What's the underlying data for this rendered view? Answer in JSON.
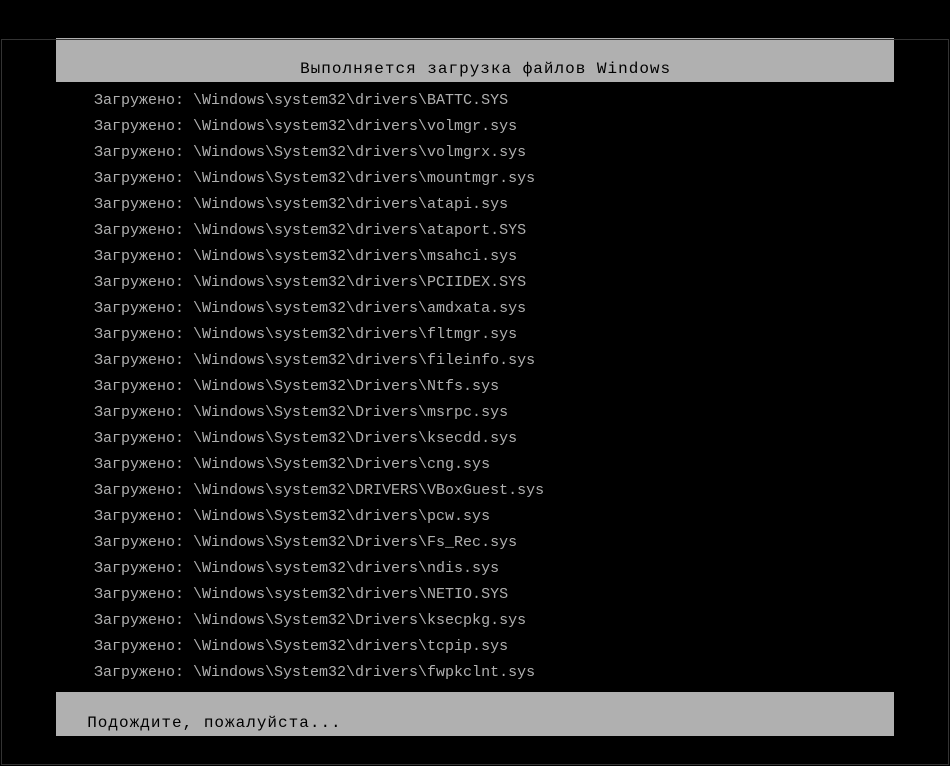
{
  "header": {
    "title": "Выполняется загрузка файлов Windows"
  },
  "log": {
    "prefix": "Загружено:",
    "files": [
      "\\Windows\\system32\\drivers\\BATTC.SYS",
      "\\Windows\\system32\\drivers\\volmgr.sys",
      "\\Windows\\System32\\drivers\\volmgrx.sys",
      "\\Windows\\System32\\drivers\\mountmgr.sys",
      "\\Windows\\system32\\drivers\\atapi.sys",
      "\\Windows\\system32\\drivers\\ataport.SYS",
      "\\Windows\\system32\\drivers\\msahci.sys",
      "\\Windows\\system32\\drivers\\PCIIDEX.SYS",
      "\\Windows\\system32\\drivers\\amdxata.sys",
      "\\Windows\\system32\\drivers\\fltmgr.sys",
      "\\Windows\\system32\\drivers\\fileinfo.sys",
      "\\Windows\\System32\\Drivers\\Ntfs.sys",
      "\\Windows\\System32\\Drivers\\msrpc.sys",
      "\\Windows\\System32\\Drivers\\ksecdd.sys",
      "\\Windows\\System32\\Drivers\\cng.sys",
      "\\Windows\\system32\\DRIVERS\\VBoxGuest.sys",
      "\\Windows\\System32\\drivers\\pcw.sys",
      "\\Windows\\System32\\Drivers\\Fs_Rec.sys",
      "\\Windows\\system32\\drivers\\ndis.sys",
      "\\Windows\\system32\\drivers\\NETIO.SYS",
      "\\Windows\\System32\\Drivers\\ksecpkg.sys",
      "\\Windows\\System32\\drivers\\tcpip.sys",
      "\\Windows\\System32\\drivers\\fwpkclnt.sys"
    ]
  },
  "footer": {
    "status": "Подождите, пожалуйста..."
  }
}
